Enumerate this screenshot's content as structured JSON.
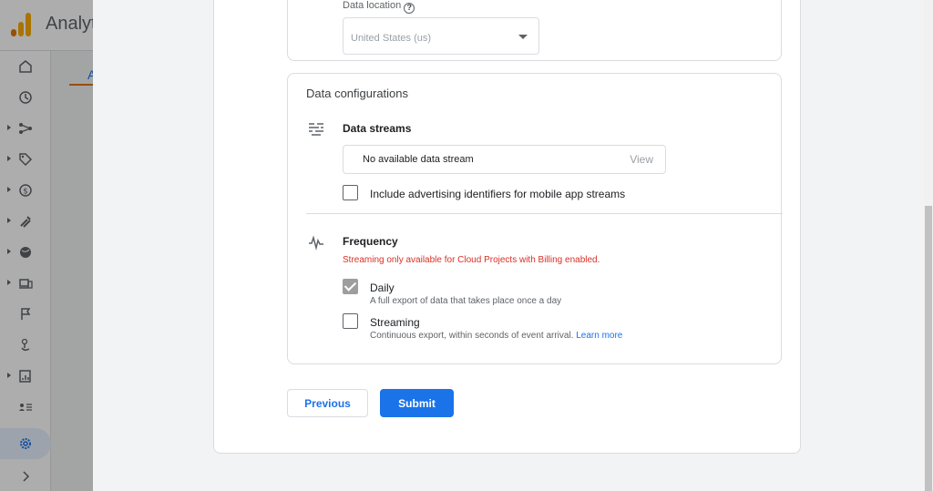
{
  "app": {
    "title": "Analytics",
    "bg_tab": "A"
  },
  "nav": [
    {
      "icon": "home-icon"
    },
    {
      "icon": "clock-icon"
    },
    {
      "icon": "flow-icon"
    },
    {
      "icon": "tag-icon"
    },
    {
      "icon": "dollar-icon"
    },
    {
      "icon": "magnet-icon"
    },
    {
      "icon": "globe-icon"
    },
    {
      "icon": "devices-icon"
    },
    {
      "icon": "flag-icon"
    },
    {
      "icon": "touch-icon"
    },
    {
      "icon": "report-icon"
    },
    {
      "icon": "list-icon"
    },
    {
      "icon": "settings-icon"
    },
    {
      "icon": "expand-icon"
    }
  ],
  "location": {
    "label": "Data location",
    "help": "?",
    "value": "United States (us)"
  },
  "config": {
    "title": "Data configurations",
    "streams": {
      "title": "Data streams",
      "box_text": "No available data stream",
      "view_label": "View",
      "ad_ids_label": "Include advertising identifiers for mobile app streams",
      "ad_ids_checked": false
    },
    "frequency": {
      "title": "Frequency",
      "warning": "Streaming only available for Cloud Projects with Billing enabled.",
      "daily_label": "Daily",
      "daily_sub": "A full export of data that takes place once a day",
      "daily_checked": true,
      "streaming_label": "Streaming",
      "streaming_sub": "Continuous export, within seconds of event arrival.",
      "streaming_link": "Learn more",
      "streaming_checked": false
    }
  },
  "actions": {
    "previous": "Previous",
    "submit": "Submit"
  },
  "colors": {
    "primary": "#1a73e8",
    "warning": "#d93025",
    "logo_orange": "#f9ab00",
    "logo_dark": "#e37400"
  }
}
